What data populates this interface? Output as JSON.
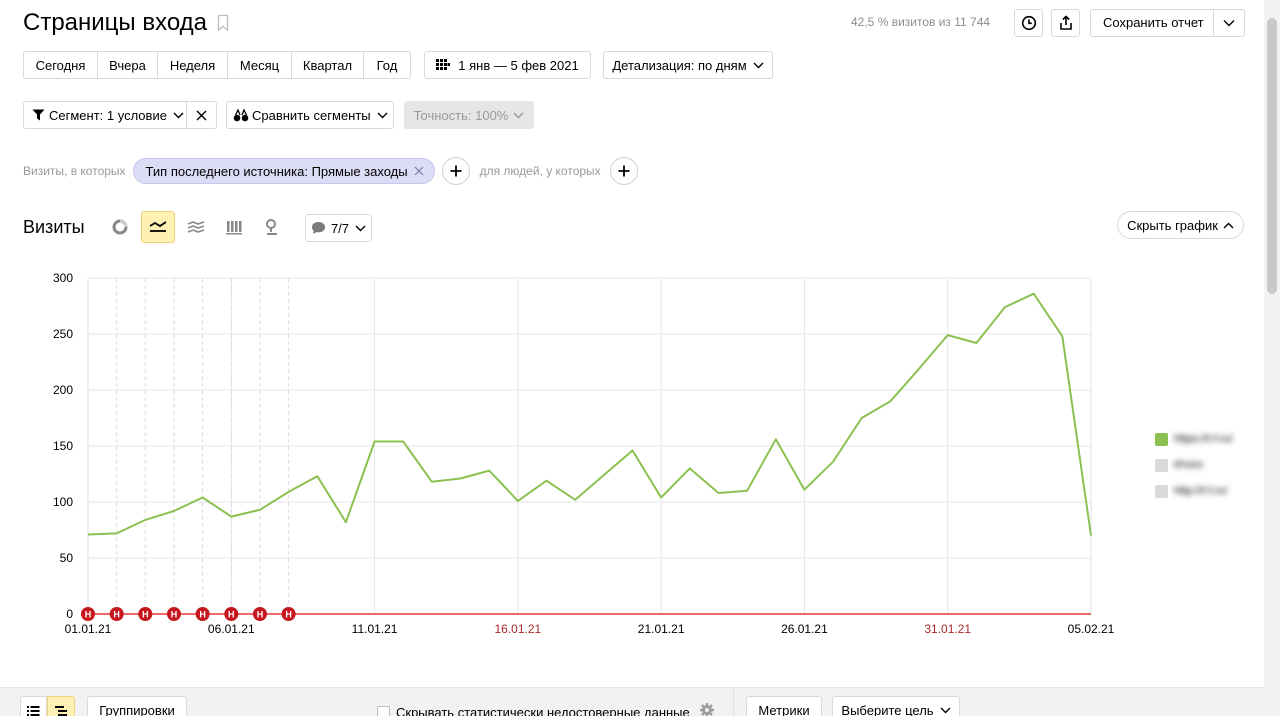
{
  "header": {
    "title": "Страницы входа",
    "summary": "42,5 % визитов из 11 744",
    "save_label": "Сохранить отчет"
  },
  "periods": [
    "Сегодня",
    "Вчера",
    "Неделя",
    "Месяц",
    "Квартал",
    "Год"
  ],
  "date_range": "1 янв — 5 фев 2021",
  "detail_label": "Детализация: по дням",
  "segment_label": "Сегмент: 1 условие",
  "compare_label": "Сравнить сегменты",
  "accuracy_label": "Точность: 100%",
  "conditions": {
    "prefix": "Визиты, в которых",
    "chip": "Тип последнего источника: Прямые заходы",
    "people_prefix": "для людей, у которых"
  },
  "chart_section": {
    "title": "Визиты",
    "notes_label": "7/7",
    "hide_label": "Скрыть график"
  },
  "chart_data": {
    "type": "line",
    "title": "",
    "xlabel": "",
    "ylabel": "",
    "ylim": [
      0,
      300
    ],
    "yticks": [
      "0",
      "50",
      "100",
      "150",
      "200",
      "250",
      "300"
    ],
    "x_labels": [
      {
        "index": 0,
        "label": "01.01.21",
        "holiday": false
      },
      {
        "index": 5,
        "label": "06.01.21",
        "holiday": false
      },
      {
        "index": 10,
        "label": "11.01.21",
        "holiday": false
      },
      {
        "index": 15,
        "label": "16.01.21",
        "holiday": true
      },
      {
        "index": 20,
        "label": "21.01.21",
        "holiday": false
      },
      {
        "index": 25,
        "label": "26.01.21",
        "holiday": false
      },
      {
        "index": 30,
        "label": "31.01.21",
        "holiday": true
      },
      {
        "index": 35,
        "label": "05.02.21",
        "holiday": false
      }
    ],
    "holiday_marker": "Н",
    "holiday_indices": [
      0,
      1,
      2,
      3,
      4,
      5,
      6,
      7
    ],
    "series": [
      {
        "color": "#8cc152",
        "values": [
          71,
          72,
          84,
          92,
          104,
          87,
          93,
          109,
          123,
          82,
          154,
          154,
          118,
          121,
          128,
          101,
          119,
          102,
          124,
          146,
          104,
          130,
          108,
          110,
          156,
          111,
          136,
          175,
          190,
          219,
          249,
          242,
          274,
          286,
          248,
          70
        ]
      },
      {
        "color": "#e53935",
        "values": [
          0,
          0,
          0,
          0,
          0,
          0,
          0,
          0,
          0,
          0,
          0,
          0,
          0,
          0,
          0,
          0,
          0,
          0,
          0,
          0,
          0,
          0,
          0,
          0,
          0,
          0,
          0,
          0,
          0,
          0,
          0,
          0,
          0,
          0,
          0,
          0
        ]
      }
    ]
  },
  "legend": {
    "items": [
      {
        "label": "https://t-f.ru/",
        "color": "#8cc152"
      },
      {
        "label": "Итого",
        "color": "#d9d9d9"
      },
      {
        "label": "http://t-f.ru/",
        "color": "#d9d9d9"
      }
    ]
  },
  "bottom": {
    "groupings_label": "Группировки",
    "hide_unreliable_label": "Скрывать статистически недостоверные данные",
    "metrics_label": "Метрики",
    "goal_label": "Выберите цель"
  }
}
